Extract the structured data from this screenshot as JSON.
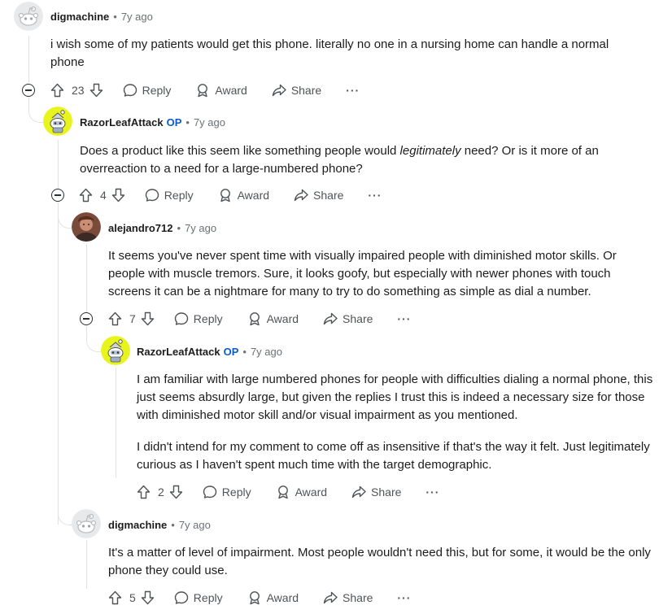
{
  "comments": [
    {
      "username": "digmachine",
      "time": "7y ago",
      "paragraphs": [
        "i wish some of my patients would get this phone. literally no one in a nursing home can handle a normal phone"
      ],
      "votes": "23",
      "avatar_icon": "reddit-snoo-default-avatar"
    },
    {
      "username": "RazorLeafAttack",
      "op": "OP",
      "time": "7y ago",
      "paragraphs_html": "Does a product like this seem like something people would <em>legitimately</em> need? Or is it more of an overreaction to a need for a large-numbered phone?",
      "paragraph_parts": [
        "Does a product like this seem like something people would ",
        "legitimately",
        " need? Or is it more of an overreaction to a need for a large-numbered phone?"
      ],
      "votes": "4",
      "avatar_icon": "yellow-robot-snoo-avatar"
    },
    {
      "username": "alejandro712",
      "time": "7y ago",
      "paragraphs": [
        "It seems you've never spent time with visually impaired people with diminished motor skills. Or people with muscle tremors. Sure, it looks goofy, but especially with newer phones with touch screens it can be a nightmare for many to try to do something as simple as dial a number."
      ],
      "votes": "7",
      "avatar_icon": "photo-avatar"
    },
    {
      "username": "RazorLeafAttack",
      "op": "OP",
      "time": "7y ago",
      "paragraphs": [
        "I am familiar with large numbered phones for people with difficulties dialing a normal phone, this just seems absurdly large, but given the replies I trust this is indeed a necessary size for those with diminished motor skill and/or visual impairment as you mentioned.",
        "I didn't intend for my comment to come off as insensitive if that's the way it felt. Just legitimately curious as I haven't spent much time with the target demographic."
      ],
      "votes": "2",
      "avatar_icon": "yellow-robot-snoo-avatar"
    },
    {
      "username": "digmachine",
      "time": "7y ago",
      "paragraphs": [
        "It's a matter of level of impairment. Most people wouldn't need this, but for some, it would be the only phone they could use."
      ],
      "votes": "5",
      "avatar_icon": "reddit-snoo-default-avatar"
    }
  ],
  "actions": {
    "reply": "Reply",
    "award": "Award",
    "share": "Share",
    "more": "···"
  },
  "separator": "•",
  "colors": {
    "op_badge": "#0a5bc8",
    "meta_text": "#6b7075",
    "thread_line": "#e0e3e5",
    "avatar_yellow": "#e8f51d"
  }
}
